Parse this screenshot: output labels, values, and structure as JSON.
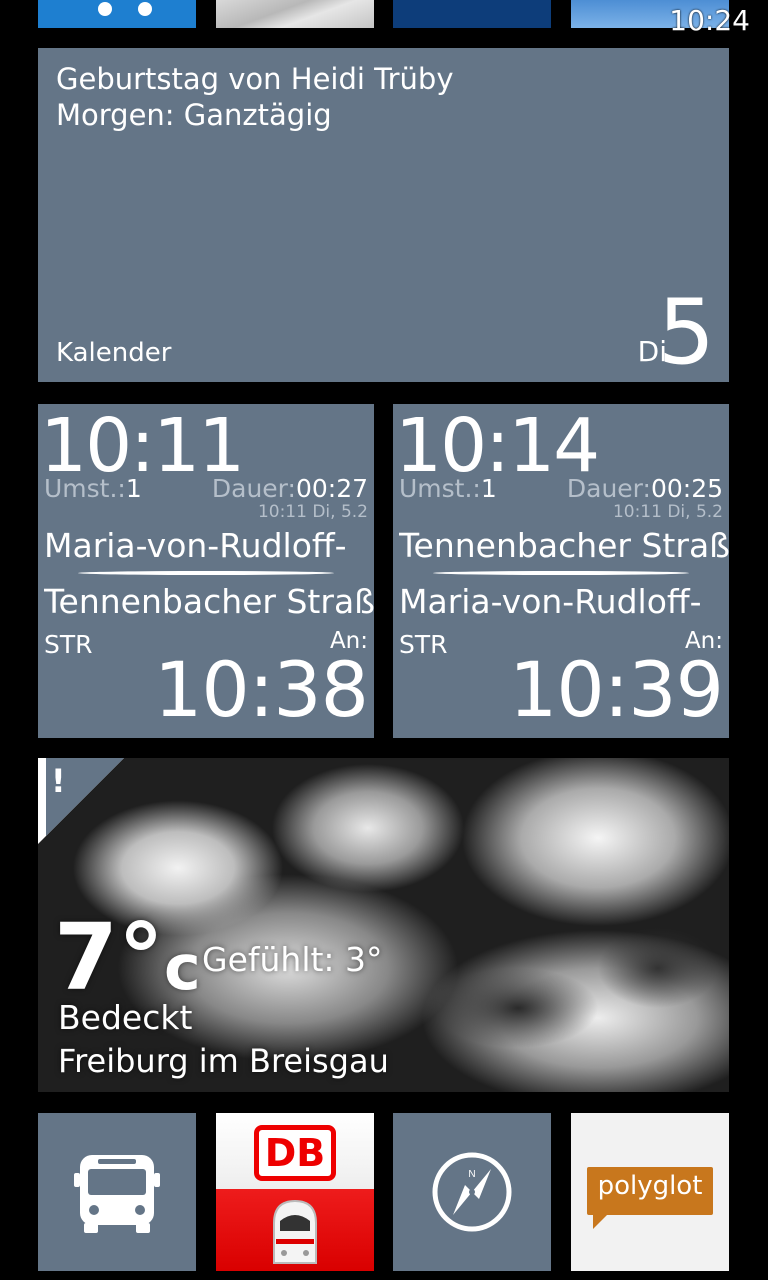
{
  "status_bar": {
    "time": "10:24"
  },
  "calendar": {
    "event_title": "Geburtstag von Heidi Trüby",
    "event_time": "Morgen: Ganztägig",
    "app_name": "Kalender",
    "weekday": "Di",
    "day": "5"
  },
  "transit": [
    {
      "departure": "10:11",
      "umst_label": "Umst.:",
      "umst_value": "1",
      "dauer_label": "Dauer:",
      "dauer_value": "00:27",
      "stamp": "10:11 Di, 5.2",
      "from": "Maria-von-Rudloff-",
      "to": "Tennenbacher Straß",
      "mode": "STR",
      "arrival_label": "An:",
      "arrival": "10:38"
    },
    {
      "departure": "10:14",
      "umst_label": "Umst.:",
      "umst_value": "1",
      "dauer_label": "Dauer:",
      "dauer_value": "00:25",
      "stamp": "10:11 Di, 5.2",
      "from": "Tennenbacher Straß",
      "to": "Maria-von-Rudloff-",
      "mode": "STR",
      "arrival_label": "An:",
      "arrival": "10:39"
    }
  ],
  "weather": {
    "alert": "!",
    "temp": "7°",
    "unit": "c",
    "feels": "Gefühlt: 3°",
    "condition": "Bedeckt",
    "city": "Freiburg im Breisgau"
  },
  "bottom_tiles": {
    "db_logo": "DB",
    "polyglot": "polyglot",
    "compass_north": "N"
  },
  "colors": {
    "tile_slate": "#647587",
    "db_red": "#e00000",
    "polyglot_orange": "#c8771d"
  }
}
